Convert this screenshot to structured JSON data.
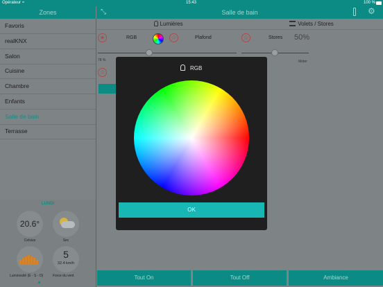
{
  "status": {
    "carrier": "Opérateur",
    "time": "15:43",
    "battery": "100 %"
  },
  "zones_header": "Zones",
  "main_header": "Salle de bain",
  "zones": [
    "Favoris",
    "realKNX",
    "Salon",
    "Cuisine",
    "Chambre",
    "Enfants",
    "Salle de bain",
    "Terrasse"
  ],
  "active_zone": "Salle de bain",
  "tabs": {
    "lights": "Lumières",
    "shutters": "Volets / Stores"
  },
  "devices": {
    "rgb": "RGB",
    "ceiling": "Plafond",
    "blinds": "Stores",
    "blinds_value": "50%",
    "dim_value": "78 %",
    "motor": "Moter"
  },
  "weather": {
    "day": "LUNDI",
    "temperature": "20.6°",
    "temp_unit": "Celsius",
    "condition": "Sec",
    "luminosity_label": "Luminosité (E - S - O)",
    "wind_value": "5",
    "wind_speed": "32.4 km/h",
    "wind_label": "Force du vent"
  },
  "buttons": {
    "all_on": "Tout On",
    "all_off": "Tout Off",
    "ambiance": "Ambiance"
  },
  "modal": {
    "title": "RGB",
    "ok": "OK"
  },
  "colors": {
    "teal": "#0b8b84",
    "ok_button": "#19b7b3",
    "modal_bg": "#1f1f1f",
    "star": "#b04a4a"
  }
}
